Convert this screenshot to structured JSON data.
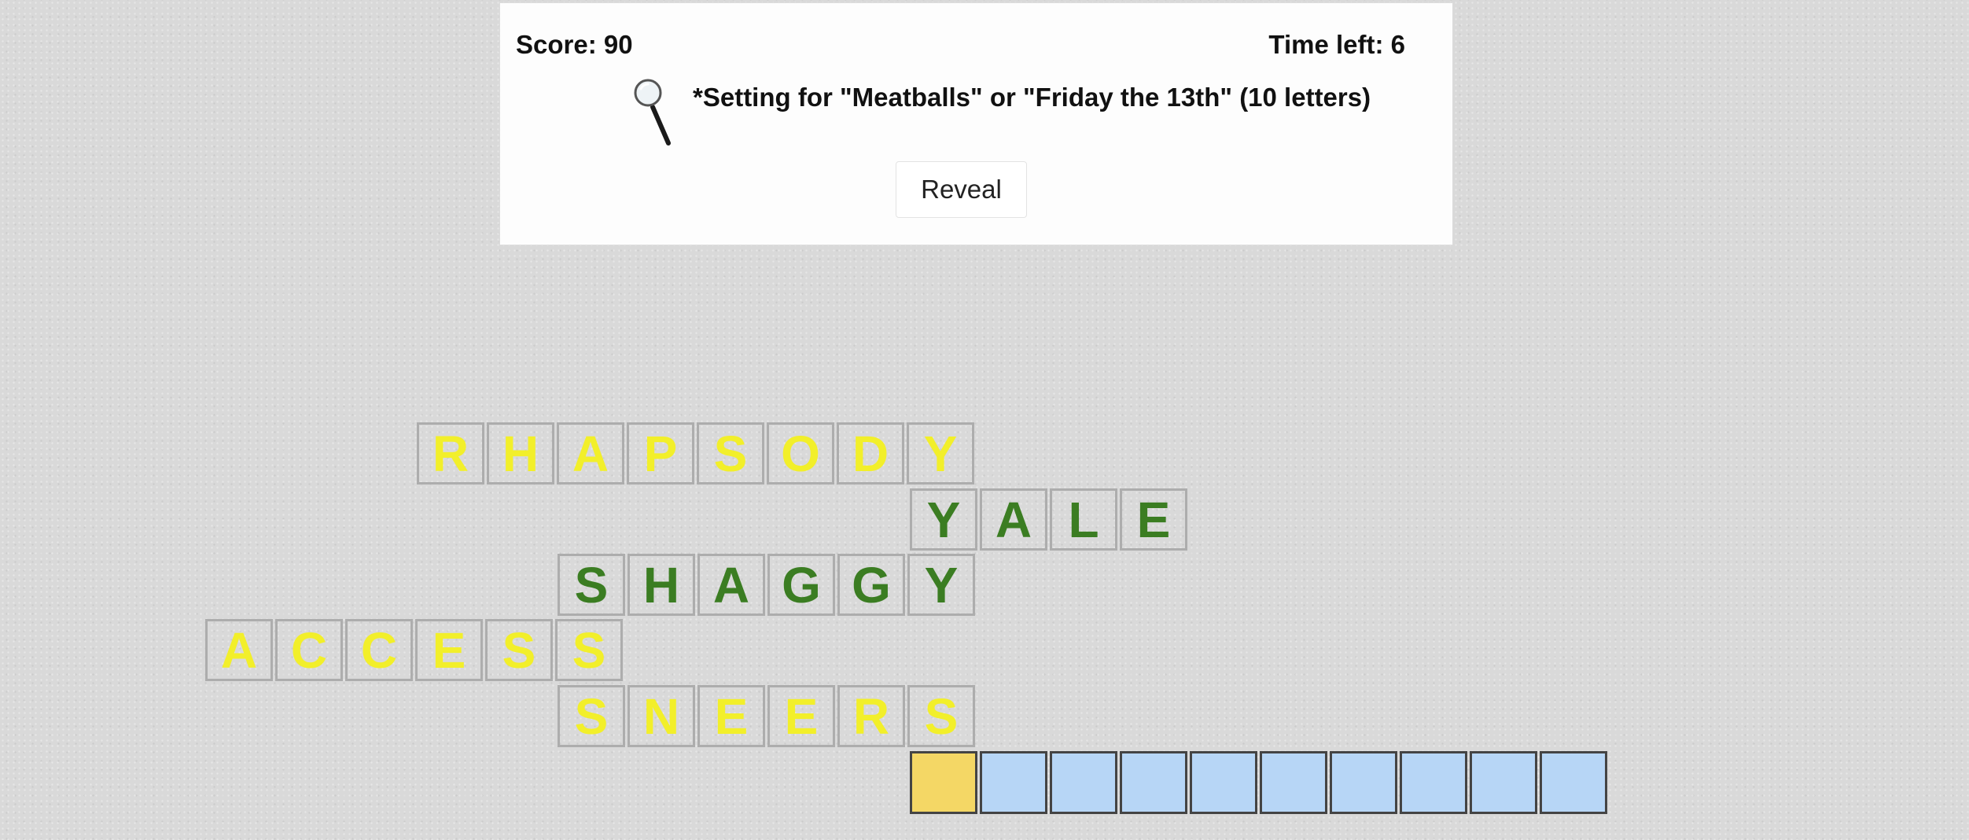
{
  "score_text": "Score: 90",
  "time_text": "Time left: 6",
  "clue_text": "*Setting for \"Meatballs\" or \"Friday the 13th\" (10 letters)",
  "hint_icon": "magnifying-glass-icon",
  "reveal_label": "Reveal",
  "colors": {
    "solved_yellow": "#f2ef2a",
    "solved_green": "#3b7d22",
    "answer_empty": "#b7d6f6",
    "answer_active": "#f4d765"
  },
  "grid": {
    "rhapsody": [
      "R",
      "H",
      "A",
      "P",
      "S",
      "O",
      "D",
      "Y"
    ],
    "yale": [
      "Y",
      "A",
      "L",
      "E"
    ],
    "shaggy": [
      "S",
      "H",
      "A",
      "G",
      "G",
      "Y"
    ],
    "access": [
      "A",
      "C",
      "C",
      "E",
      "S",
      "S"
    ],
    "sneers": [
      "S",
      "N",
      "E",
      "E",
      "R",
      "S"
    ]
  },
  "answer": {
    "length": 10,
    "active_index": 0
  }
}
